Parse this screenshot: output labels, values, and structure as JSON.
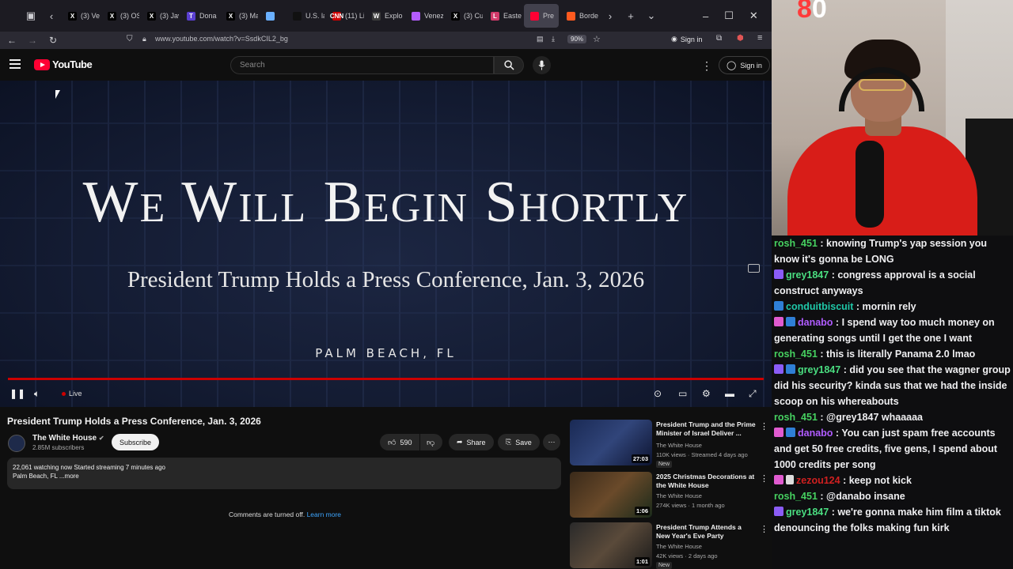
{
  "browser": {
    "tabs": [
      {
        "label": "(3) Ve",
        "fav": "X",
        "color": "#000000"
      },
      {
        "label": "(3) OS",
        "fav": "X",
        "color": "#000000"
      },
      {
        "label": "(3) Jav",
        "fav": "X",
        "color": "#000000"
      },
      {
        "label": "Dona",
        "fav": "T",
        "color": "#5a3fd0"
      },
      {
        "label": "(3) Ma",
        "fav": "X",
        "color": "#000000"
      },
      {
        "label": "",
        "fav": "",
        "color": "#6ab0ff"
      },
      {
        "label": "U.S. la",
        "fav": "",
        "color": "#111111"
      },
      {
        "label": "(11) Li",
        "fav": "CNN",
        "color": "#cc0000"
      },
      {
        "label": "Explo",
        "fav": "W",
        "color": "#3b3b3b"
      },
      {
        "label": "Venez",
        "fav": "",
        "color": "#b45cff"
      },
      {
        "label": "(3) Cu",
        "fav": "X",
        "color": "#000000"
      },
      {
        "label": "Easte",
        "fav": "L",
        "color": "#d23a6a"
      },
      {
        "label": "Pre",
        "fav": "",
        "color": "#ff0033",
        "active": true
      },
      {
        "label": "Borde",
        "fav": "",
        "color": "#ff5a1f"
      }
    ],
    "url": "www.youtube.com/watch?v=SsdkCIL2_bg",
    "zoom": "90%",
    "sign_in": "Sign in"
  },
  "youtube": {
    "logo": "YouTube",
    "search_placeholder": "Search",
    "sign_in": "Sign in"
  },
  "video": {
    "headline": "We Will Begin Shortly",
    "subtitle": "President Trump Holds a Press Conference, Jan. 3, 2026",
    "location": "PALM BEACH, FL",
    "live_label": "Live"
  },
  "details": {
    "title": "President Trump Holds a Press Conference, Jan. 3, 2026",
    "channel": "The White House",
    "subscribers": "2.85M subscribers",
    "subscribe": "Subscribe",
    "likes": "590",
    "share": "Share",
    "save": "Save",
    "watching": "22,061 watching now  Started streaming 7 minutes ago",
    "desc_line": "Palm Beach, FL",
    "more": "...more",
    "comments_off": "Comments are turned off.",
    "learn_more": "Learn more"
  },
  "recommendations": [
    {
      "title": "President Trump and the Prime Minister of Israel Deliver ...",
      "channel": "The White House",
      "meta": "110K views · Streamed 4 days ago",
      "badge": "New",
      "duration": "27:03"
    },
    {
      "title": "2025 Christmas Decorations at the White House",
      "channel": "The White House",
      "meta": "274K views · 1 month ago",
      "badge": "",
      "duration": "1:06"
    },
    {
      "title": "President Trump Attends a New Year's Eve Party",
      "channel": "The White House",
      "meta": "42K views · 2 days ago",
      "badge": "New",
      "duration": "1:01"
    }
  ],
  "webcam": {
    "score": "0"
  },
  "chat": [
    {
      "user": "rosh_451",
      "badge": "",
      "color": "u-green",
      "text": "knowing Trump's yap session you know it's gonna be LONG"
    },
    {
      "user": "grey1847",
      "badge": "purple",
      "color": "u-lime",
      "text": "congress approval is a social construct anyways"
    },
    {
      "user": "conduitbiscuit",
      "badge": "blue",
      "color": "u-teal",
      "text": "mornin rely"
    },
    {
      "user": "danabo",
      "badge": "pink-blue",
      "color": "u-violet",
      "text": "I spend way too much money on generating songs until I get the one I want"
    },
    {
      "user": "rosh_451",
      "badge": "",
      "color": "u-green",
      "text": "this is literally Panama 2.0 lmao"
    },
    {
      "user": "grey1847",
      "badge": "purple-blue",
      "color": "u-lime",
      "text": "did you see that the wagner group did his security? kinda sus that we had the inside scoop on his whereabouts"
    },
    {
      "user": "rosh_451",
      "badge": "",
      "color": "u-green",
      "text": "@grey1847 whaaaaa"
    },
    {
      "user": "danabo",
      "badge": "pink-blue",
      "color": "u-violet",
      "text": "You can just spam free accounts and get 50 free credits, five gens, I spend about 1000 credits per song"
    },
    {
      "user": "zezou124",
      "badge": "pink-sound",
      "color": "u-red",
      "text": "keep not kick"
    },
    {
      "user": "rosh_451",
      "badge": "",
      "color": "u-green",
      "text": "@danabo insane"
    },
    {
      "user": "grey1847",
      "badge": "purple",
      "color": "u-lime",
      "text": "we're gonna make him film a tiktok denouncing the folks making fun kirk"
    }
  ]
}
